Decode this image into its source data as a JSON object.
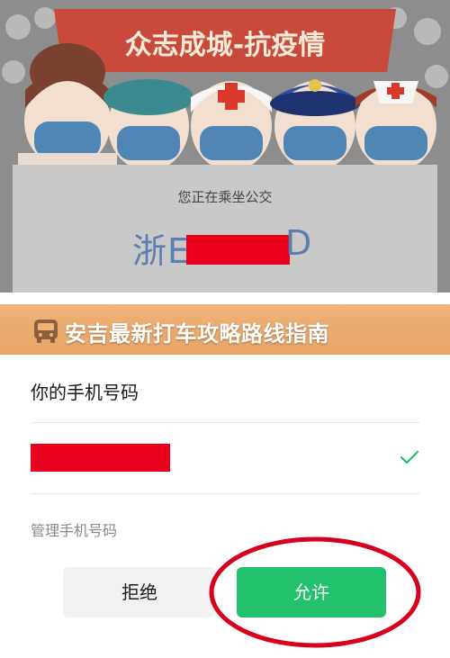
{
  "illustration": {
    "banner_text": "众志成城-抗疫情"
  },
  "ride_card": {
    "riding_text": "您正在乘坐公交",
    "plate_prefix": "浙E",
    "plate_suffix": "D"
  },
  "title_banner": {
    "text": "安吉最新打车攻略路线指南",
    "icon": "bus-icon"
  },
  "phone_section": {
    "heading": "你的手机号码",
    "manage_label": "管理手机号码",
    "selected_icon": "check-icon"
  },
  "buttons": {
    "reject_label": "拒绝",
    "allow_label": "允许"
  },
  "colors": {
    "accent_green": "#21c26b",
    "redaction_red": "#e8001c",
    "banner_orange": "#e8a465",
    "annotation_red": "#d6001c",
    "plate_blue": "#5b7fb0"
  }
}
